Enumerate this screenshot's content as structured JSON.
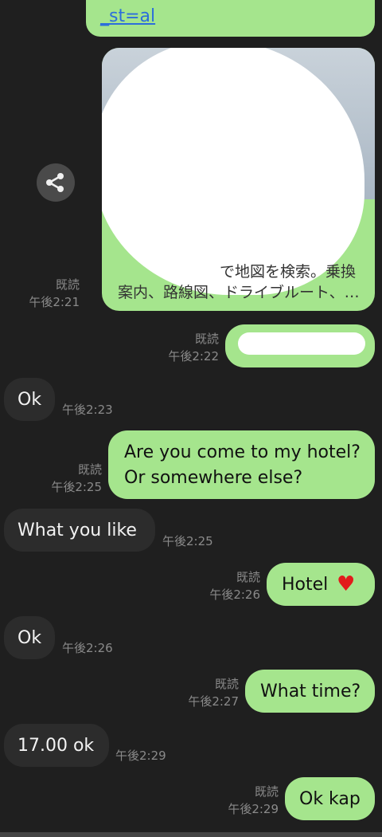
{
  "top_link": {
    "text": "_st=al"
  },
  "map_card": {
    "line1": "で地図を検索。乗換",
    "line2": "案内、路線図、ドライブルート、…"
  },
  "messages": [
    {
      "id": "m1",
      "side": "out",
      "text": "",
      "read": "既読",
      "time": "午後2:21"
    },
    {
      "id": "m2",
      "side": "out",
      "text": "",
      "read": "既読",
      "time": "午後2:22"
    },
    {
      "id": "m3",
      "side": "in",
      "text": "Ok",
      "time": "午後2:23"
    },
    {
      "id": "m4",
      "side": "out",
      "line1": "Are you come to my hotel?",
      "line2": "Or somewhere else?",
      "read": "既読",
      "time": "午後2:25"
    },
    {
      "id": "m5",
      "side": "in",
      "text": "What you like",
      "time": "午後2:25"
    },
    {
      "id": "m6",
      "side": "out",
      "text": "Hotel",
      "emoji": "♥",
      "read": "既読",
      "time": "午後2:26"
    },
    {
      "id": "m7",
      "side": "in",
      "text": "Ok",
      "time": "午後2:26"
    },
    {
      "id": "m8",
      "side": "out",
      "text": "What time?",
      "read": "既読",
      "time": "午後2:27"
    },
    {
      "id": "m9",
      "side": "in",
      "text": "17.00 ok",
      "time": "午後2:29"
    },
    {
      "id": "m10",
      "side": "out",
      "text": "Ok kap",
      "read": "既読",
      "time": "午後2:29"
    }
  ],
  "share_button": {
    "icon": "share-icon"
  },
  "colors": {
    "background": "#1f1f1f",
    "outgoing_bubble": "#a5e58d",
    "incoming_bubble": "#2c2c2c",
    "meta_text": "#8a8a8a"
  }
}
